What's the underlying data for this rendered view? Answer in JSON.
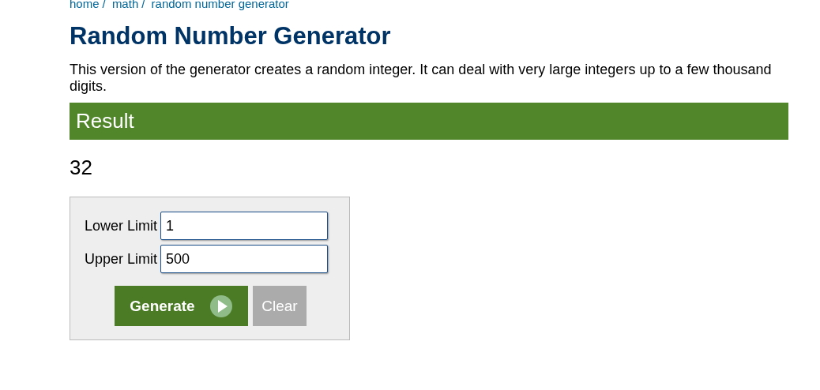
{
  "breadcrumb": {
    "separator": "/",
    "items": [
      {
        "label": "home"
      },
      {
        "label": "math"
      },
      {
        "label": "random number generator"
      }
    ]
  },
  "title": "Random Number Generator",
  "description": "This version of the generator creates a random integer. It can deal with very large integers up to a few thousand digits.",
  "result": {
    "heading": "Result",
    "value": "32"
  },
  "form": {
    "fields": [
      {
        "label": "Lower Limit",
        "value": "1"
      },
      {
        "label": "Upper Limit",
        "value": "500"
      }
    ],
    "buttons": [
      {
        "label": "Generate",
        "kind": "primary"
      },
      {
        "label": "Clear",
        "kind": "secondary"
      }
    ]
  }
}
